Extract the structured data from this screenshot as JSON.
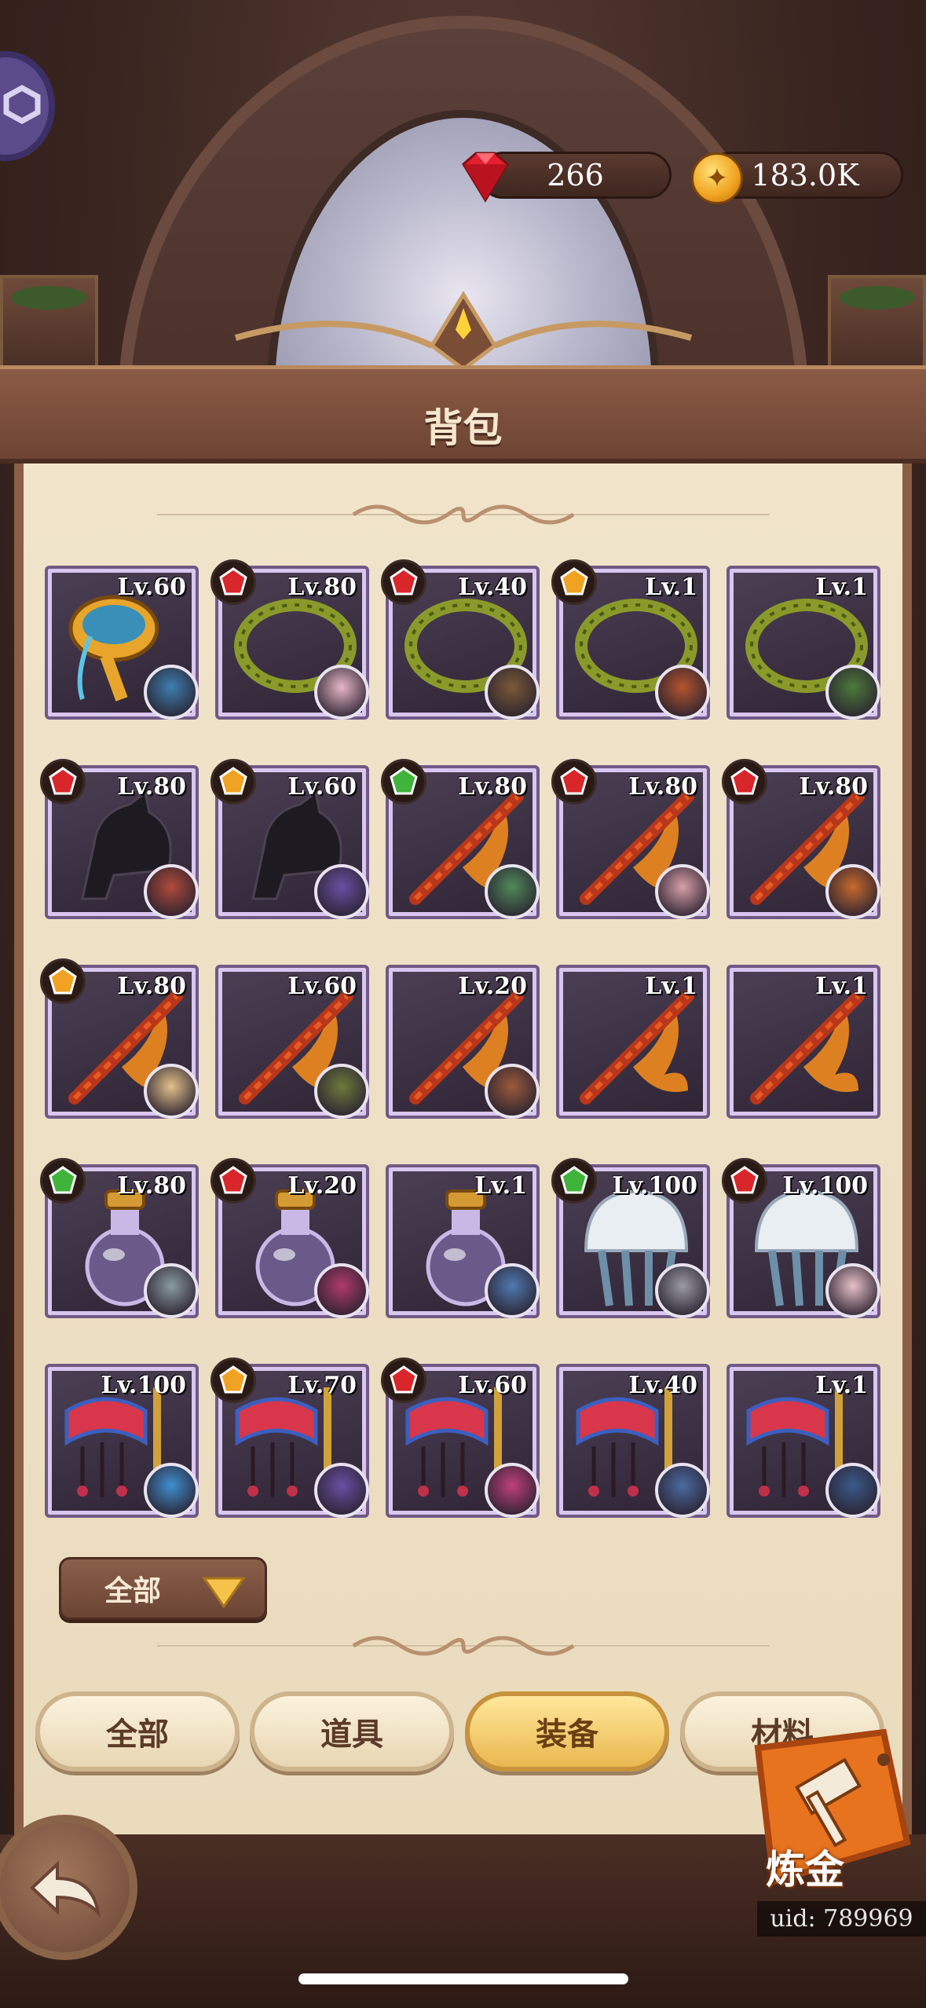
{
  "currency": {
    "gems": "266",
    "gold": "183.0K"
  },
  "panel": {
    "title": "背包"
  },
  "items": [
    {
      "level": "Lv.60",
      "type": "goblet",
      "rarity": "",
      "hero": "#3d7fb0"
    },
    {
      "level": "Lv.80",
      "type": "thorns",
      "rarity": "red",
      "hero": "#e8b7c6"
    },
    {
      "level": "Lv.40",
      "type": "thorns",
      "rarity": "red",
      "hero": "#7a5a35"
    },
    {
      "level": "Lv.1",
      "type": "thorns",
      "rarity": "orange",
      "hero": "#b5542c"
    },
    {
      "level": "Lv.1",
      "type": "thorns",
      "rarity": "",
      "hero": "#4c7a3a"
    },
    {
      "level": "Lv.80",
      "type": "horse",
      "rarity": "red",
      "hero": "#b04a3a"
    },
    {
      "level": "Lv.60",
      "type": "horse",
      "rarity": "orange",
      "hero": "#6a4fa3"
    },
    {
      "level": "Lv.80",
      "type": "flute",
      "rarity": "green",
      "hero": "#4e8a5a"
    },
    {
      "level": "Lv.80",
      "type": "flute",
      "rarity": "red",
      "hero": "#d9a0a8"
    },
    {
      "level": "Lv.80",
      "type": "flute",
      "rarity": "red",
      "hero": "#c76a2c"
    },
    {
      "level": "Lv.80",
      "type": "flute",
      "rarity": "orange",
      "hero": "#e4c28a"
    },
    {
      "level": "Lv.60",
      "type": "flute",
      "rarity": "",
      "hero": "#6d7a3a"
    },
    {
      "level": "Lv.20",
      "type": "flute",
      "rarity": "",
      "hero": "#9a5a3a"
    },
    {
      "level": "Lv.1",
      "type": "flute",
      "rarity": "",
      "hero": ""
    },
    {
      "level": "Lv.1",
      "type": "flute",
      "rarity": "",
      "hero": ""
    },
    {
      "level": "Lv.80",
      "type": "potion",
      "rarity": "green",
      "hero": "#8a9aa0"
    },
    {
      "level": "Lv.20",
      "type": "potion",
      "rarity": "red",
      "hero": "#b03a6a"
    },
    {
      "level": "Lv.1",
      "type": "potion",
      "rarity": "",
      "hero": "#4e7ab0"
    },
    {
      "level": "Lv.100",
      "type": "jellyfish",
      "rarity": "green",
      "hero": "#9a9aa5"
    },
    {
      "level": "Lv.100",
      "type": "jellyfish",
      "rarity": "red",
      "hero": "#e8c0c8"
    },
    {
      "level": "Lv.100",
      "type": "banner",
      "rarity": "",
      "hero": "#3f8fd0"
    },
    {
      "level": "Lv.70",
      "type": "banner",
      "rarity": "orange",
      "hero": "#6a4fa3"
    },
    {
      "level": "Lv.60",
      "type": "banner",
      "rarity": "red",
      "hero": "#c0407a"
    },
    {
      "level": "Lv.40",
      "type": "banner",
      "rarity": "",
      "hero": "#4a6aa0"
    },
    {
      "level": "Lv.1",
      "type": "banner",
      "rarity": "",
      "hero": "#3a5a8a"
    }
  ],
  "filter": {
    "label": "全部"
  },
  "tabs": [
    {
      "label": "全部",
      "active": false
    },
    {
      "label": "道具",
      "active": false
    },
    {
      "label": "装备",
      "active": true
    },
    {
      "label": "材料",
      "active": false
    }
  ],
  "alchemy": {
    "label": "炼金"
  },
  "uid": "uid: 789969",
  "colors": {
    "rarity_red": "#d8262a",
    "rarity_orange": "#f0a322",
    "rarity_green": "#3fb33a",
    "frame_purple": "#6f5a86",
    "parchment": "#efe1c6"
  }
}
